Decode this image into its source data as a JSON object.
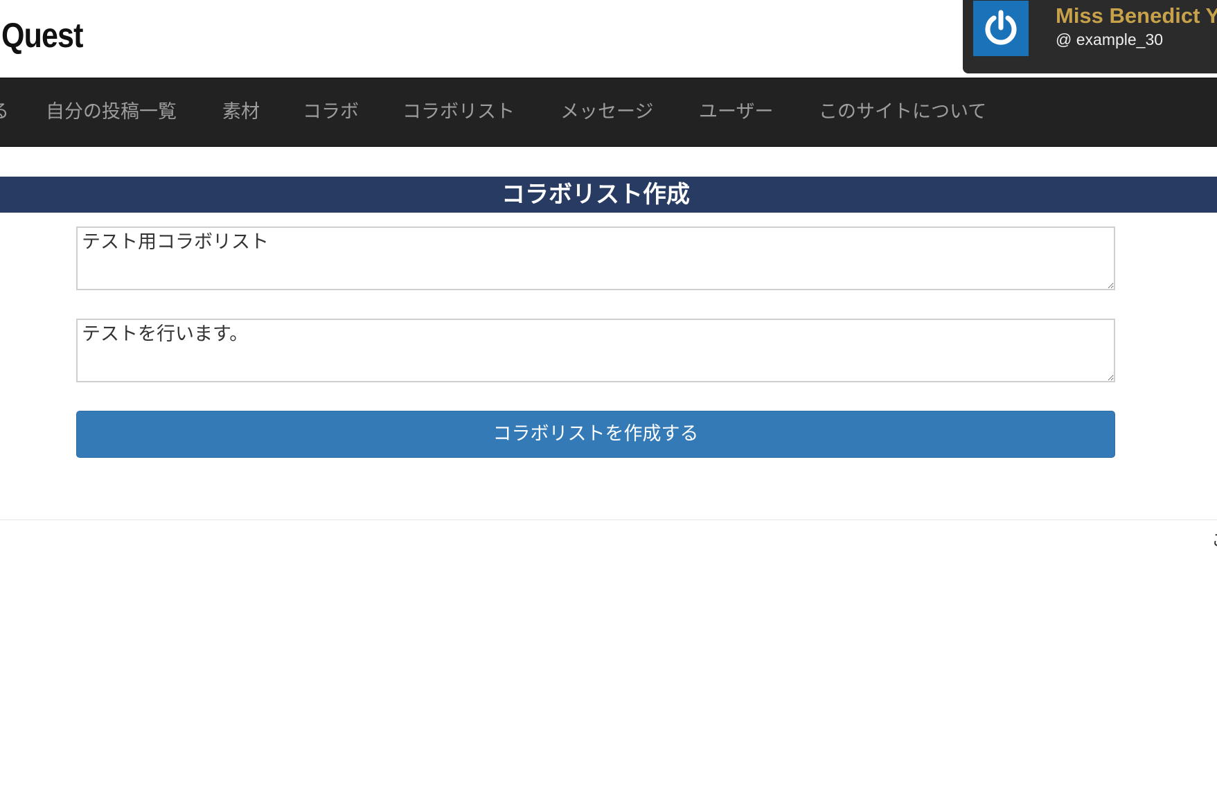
{
  "header": {
    "logo_text": "Quest",
    "user": {
      "name": "Miss Benedict Y",
      "handle": "@ example_30",
      "avatar_icon": "power-icon",
      "avatar_color": "#1a73b8",
      "name_color": "#c8a24a"
    }
  },
  "nav": {
    "clipped_item": "る",
    "items": [
      {
        "label": "自分の投稿一覧"
      },
      {
        "label": "素材"
      },
      {
        "label": "コラボ"
      },
      {
        "label": "コラボリスト"
      },
      {
        "label": "メッセージ"
      },
      {
        "label": "ユーザー"
      },
      {
        "label": "このサイトについて"
      }
    ]
  },
  "page": {
    "title": "コラボリスト作成",
    "title_bar_color": "#283b63"
  },
  "form": {
    "title_value": "テスト用コラボリスト",
    "description_value": "テストを行います。",
    "submit_label": "コラボリストを作成する",
    "submit_color": "#337ab7"
  },
  "footer": {
    "clipped_text": "こ"
  }
}
